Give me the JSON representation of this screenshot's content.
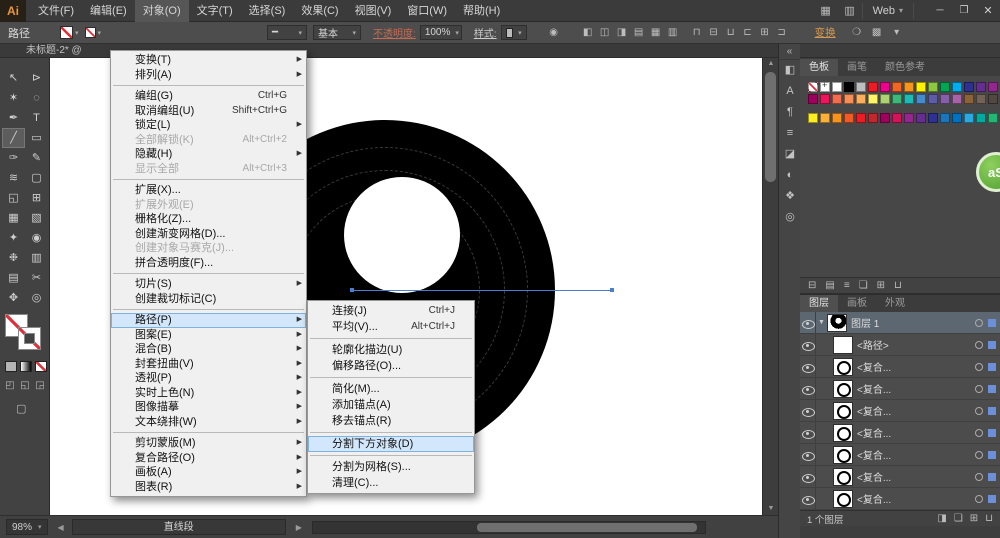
{
  "ui": {
    "caret": "▾",
    "menu_arrow": "▶",
    "up_arrow": "▲",
    "down_arrow": "▼",
    "left_arrow": "◀",
    "right_arrow": "▶",
    "expand_dock": "«",
    "panel_menu": "≡",
    "profile_glyph": "━"
  },
  "title_bar": {
    "logo": "Ai",
    "menus": [
      {
        "label": "文件(F)",
        "name": "menubar-file"
      },
      {
        "label": "编辑(E)",
        "name": "menubar-edit"
      },
      {
        "label": "对象(O)",
        "name": "menubar-object",
        "open": true
      },
      {
        "label": "文字(T)",
        "name": "menubar-type"
      },
      {
        "label": "选择(S)",
        "name": "menubar-select"
      },
      {
        "label": "效果(C)",
        "name": "menubar-effect"
      },
      {
        "label": "视图(V)",
        "name": "menubar-view"
      },
      {
        "label": "窗口(W)",
        "name": "menubar-window"
      },
      {
        "label": "帮助(H)",
        "name": "menubar-help"
      }
    ],
    "icons": [
      {
        "name": "arrange-documents-icon",
        "glyph": "▦"
      },
      {
        "name": "document-layout-icon",
        "glyph": "▥"
      }
    ],
    "workspace": "Web",
    "window_controls": [
      {
        "name": "minimize-button",
        "glyph": "─"
      },
      {
        "name": "restore-button",
        "glyph": "❐"
      },
      {
        "name": "close-button",
        "glyph": "✕"
      }
    ]
  },
  "control_bar": {
    "context_label": "路径",
    "brush_def": "基本",
    "opacity_label": "不透明度:",
    "opacity_value": "100%",
    "style_label": "样式:",
    "transform_label": "变换",
    "extra_icons": [
      {
        "name": "recolor-artwork-icon",
        "glyph": "◉"
      }
    ],
    "align_icons": [
      {
        "name": "align-left-icon",
        "glyph": "◧"
      },
      {
        "name": "align-h-center-icon",
        "glyph": "◫"
      },
      {
        "name": "align-right-icon",
        "glyph": "◨"
      },
      {
        "name": "align-top-icon",
        "glyph": "▤"
      },
      {
        "name": "align-v-center-icon",
        "glyph": "▦"
      },
      {
        "name": "align-bottom-icon",
        "glyph": "▥"
      }
    ],
    "distribute_icons": [
      {
        "name": "distribute-top-icon",
        "glyph": "⊓"
      },
      {
        "name": "distribute-v-center-icon",
        "glyph": "⊟"
      },
      {
        "name": "distribute-bottom-icon",
        "glyph": "⊔"
      },
      {
        "name": "distribute-left-icon",
        "glyph": "⊏"
      },
      {
        "name": "distribute-h-center-icon",
        "glyph": "⊞"
      },
      {
        "name": "distribute-right-icon",
        "glyph": "⊐"
      }
    ],
    "right_icons": [
      {
        "name": "shape-mode-icon",
        "glyph": "❍"
      },
      {
        "name": "arrange-icon",
        "glyph": "▩"
      },
      {
        "name": "panel-options-icon",
        "glyph": "▾"
      }
    ]
  },
  "document_tab": {
    "label": "未标题-2* @"
  },
  "tools": [
    {
      "name": "selection-tool",
      "glyph": "↖"
    },
    {
      "name": "direct-selection-tool",
      "glyph": "⊳"
    },
    {
      "name": "magic-wand-tool",
      "glyph": "✶"
    },
    {
      "name": "lasso-tool",
      "glyph": "◌"
    },
    {
      "name": "pen-tool",
      "glyph": "✒"
    },
    {
      "name": "type-tool",
      "glyph": "T"
    },
    {
      "name": "line-segment-tool",
      "glyph": "╱",
      "active": true
    },
    {
      "name": "rectangle-tool",
      "glyph": "▭"
    },
    {
      "name": "paintbrush-tool",
      "glyph": "✑"
    },
    {
      "name": "pencil-tool",
      "glyph": "✎"
    },
    {
      "name": "width-tool",
      "glyph": "≋"
    },
    {
      "name": "free-transform-tool",
      "glyph": "▢"
    },
    {
      "name": "shape-builder-tool",
      "glyph": "◱"
    },
    {
      "name": "perspective-grid-tool",
      "glyph": "⊞"
    },
    {
      "name": "mesh-tool",
      "glyph": "▦"
    },
    {
      "name": "gradient-tool",
      "glyph": "▧"
    },
    {
      "name": "eyedropper-tool",
      "glyph": "✦"
    },
    {
      "name": "blend-tool",
      "glyph": "◉"
    },
    {
      "name": "symbol-sprayer-tool",
      "glyph": "❉"
    },
    {
      "name": "column-graph-tool",
      "glyph": "▥"
    },
    {
      "name": "artboard-tool",
      "glyph": "▤"
    },
    {
      "name": "slice-tool",
      "glyph": "✂"
    },
    {
      "name": "hand-tool",
      "glyph": "✥"
    },
    {
      "name": "zoom-tool",
      "glyph": "◎"
    }
  ],
  "tools_footer": {
    "mode_icons": [
      {
        "name": "draw-normal-icon",
        "glyph": "◰"
      },
      {
        "name": "draw-behind-icon",
        "glyph": "◱"
      },
      {
        "name": "draw-inside-icon",
        "glyph": "◲"
      }
    ],
    "screen_mode": {
      "name": "screen-mode-icon",
      "glyph": "▢"
    }
  },
  "object_menu": {
    "items": [
      {
        "label": "变换(T)",
        "arrow": true
      },
      {
        "label": "排列(A)",
        "arrow": true
      },
      {
        "type": "sep"
      },
      {
        "label": "编组(G)",
        "shortcut": "Ctrl+G"
      },
      {
        "label": "取消编组(U)",
        "shortcut": "Shift+Ctrl+G"
      },
      {
        "label": "锁定(L)",
        "arrow": true
      },
      {
        "label": "全部解锁(K)",
        "shortcut": "Alt+Ctrl+2",
        "disabled": true
      },
      {
        "label": "隐藏(H)",
        "arrow": true
      },
      {
        "label": "显示全部",
        "shortcut": "Alt+Ctrl+3",
        "disabled": true
      },
      {
        "type": "sep"
      },
      {
        "label": "扩展(X)..."
      },
      {
        "label": "扩展外观(E)",
        "disabled": true
      },
      {
        "label": "栅格化(Z)..."
      },
      {
        "label": "创建渐变网格(D)..."
      },
      {
        "label": "创建对象马赛克(J)...",
        "disabled": true
      },
      {
        "label": "拼合透明度(F)..."
      },
      {
        "type": "sep"
      },
      {
        "label": "切片(S)",
        "arrow": true
      },
      {
        "label": "创建裁切标记(C)"
      },
      {
        "type": "sep"
      },
      {
        "label": "路径(P)",
        "arrow": true,
        "highlight": true,
        "name": "menu-item-path"
      },
      {
        "label": "图案(E)",
        "arrow": true
      },
      {
        "label": "混合(B)",
        "arrow": true
      },
      {
        "label": "封套扭曲(V)",
        "arrow": true
      },
      {
        "label": "透视(P)",
        "arrow": true
      },
      {
        "label": "实时上色(N)",
        "arrow": true
      },
      {
        "label": "图像描摹",
        "arrow": true
      },
      {
        "label": "文本绕排(W)",
        "arrow": true
      },
      {
        "type": "sep"
      },
      {
        "label": "剪切蒙版(M)",
        "arrow": true
      },
      {
        "label": "复合路径(O)",
        "arrow": true
      },
      {
        "label": "画板(A)",
        "arrow": true
      },
      {
        "label": "图表(R)",
        "arrow": true
      }
    ]
  },
  "path_submenu": {
    "items": [
      {
        "label": "连接(J)",
        "shortcut": "Ctrl+J"
      },
      {
        "label": "平均(V)...",
        "shortcut": "Alt+Ctrl+J"
      },
      {
        "type": "sep"
      },
      {
        "label": "轮廓化描边(U)"
      },
      {
        "label": "偏移路径(O)..."
      },
      {
        "type": "sep"
      },
      {
        "label": "简化(M)..."
      },
      {
        "label": "添加锚点(A)"
      },
      {
        "label": "移去锚点(R)"
      },
      {
        "type": "sep"
      },
      {
        "label": "分割下方对象(D)",
        "highlight": true,
        "name": "menu-item-divide-objects-below"
      },
      {
        "type": "sep"
      },
      {
        "label": "分割为网格(S)..."
      },
      {
        "label": "清理(C)..."
      }
    ]
  },
  "dock_icons": [
    {
      "name": "color-panel-icon",
      "glyph": "◧"
    },
    {
      "name": "character-panel-icon",
      "glyph": "A"
    },
    {
      "name": "paragraph-panel-icon",
      "glyph": "¶"
    },
    {
      "name": "stroke-panel-icon",
      "glyph": "≡"
    },
    {
      "name": "gradient-panel-icon",
      "glyph": "◪"
    },
    {
      "name": "transparency-panel-icon",
      "glyph": "◐"
    },
    {
      "name": "symbols-panel-icon",
      "glyph": "❖"
    },
    {
      "name": "appearance-panel-icon",
      "glyph": "◎"
    }
  ],
  "swatches": {
    "tabs": [
      {
        "label": "色板",
        "active": true
      },
      {
        "label": "画笔"
      },
      {
        "label": "颜色参考"
      }
    ],
    "row1": [
      "none",
      "reg",
      "#ffffff",
      "#000000",
      "#bcbec0",
      "#ed1c24",
      "#ec008c",
      "#f26522",
      "#f7941d",
      "#fff200",
      "#8dc63f",
      "#00a651",
      "#00aeef",
      "#2e3192",
      "#662d91",
      "#92278f"
    ],
    "row2": [
      "#9e005d",
      "#ed145b",
      "#f26c4f",
      "#f68e55",
      "#fbaf5c",
      "#fff467",
      "#acd372",
      "#3cb878",
      "#1cbbb4",
      "#448ccb",
      "#5e5ca7",
      "#855fa8",
      "#a763a9",
      "#8c6239",
      "#736357",
      "#534741"
    ],
    "row3": [
      "#fcee21",
      "#fbb03b",
      "#f7931e",
      "#f15a24",
      "#ed1c24",
      "#c1272d",
      "#9e005d",
      "#d4145a",
      "#93278f",
      "#662d91",
      "#2e3192",
      "#1b75bb",
      "#0071bc",
      "#29abe2",
      "#00a99d",
      "#22b573"
    ],
    "row4": [
      "#006837",
      "#8cc63f",
      "#d9e021",
      "#ffffff",
      "#e6e6e6",
      "#cccccc",
      "#b3b3b3",
      "#999999",
      "#808080",
      "#4d4d4d",
      "#333333",
      "#1a1a1a",
      "#000000",
      "folder",
      "folder",
      "folder"
    ],
    "footer_icons": [
      {
        "name": "swatch-libraries-icon",
        "glyph": "⊟"
      },
      {
        "name": "swatch-kinds-icon",
        "glyph": "▤"
      },
      {
        "name": "swatch-options-icon",
        "glyph": "≡"
      },
      {
        "name": "new-color-group-icon",
        "glyph": "❏"
      },
      {
        "name": "new-swatch-icon",
        "glyph": "⊞"
      },
      {
        "name": "delete-swatch-icon",
        "glyph": "⊔"
      }
    ]
  },
  "layers": {
    "tabs": [
      {
        "label": "图层",
        "active": true
      },
      {
        "label": "画板"
      },
      {
        "label": "外观"
      }
    ],
    "rows": [
      {
        "label": "图层 1",
        "thumb": "donut",
        "selected": true,
        "expanded": true,
        "name": "layer-row"
      },
      {
        "label": "<路径>",
        "thumb": "square",
        "name": "path-row"
      },
      {
        "label": "<复合...",
        "thumb": "ring",
        "name": "compound-path-row"
      },
      {
        "label": "<复合...",
        "thumb": "ring",
        "name": "compound-path-row"
      },
      {
        "label": "<复合...",
        "thumb": "ring",
        "name": "compound-path-row"
      },
      {
        "label": "<复合...",
        "thumb": "ring",
        "name": "compound-path-row"
      },
      {
        "label": "<复合...",
        "thumb": "ring",
        "name": "compound-path-row"
      },
      {
        "label": "<复合...",
        "thumb": "ring",
        "name": "compound-path-row"
      },
      {
        "label": "<复合...",
        "thumb": "ring",
        "name": "compound-path-row"
      }
    ],
    "footer": "1 个图层",
    "footer_icons": [
      {
        "name": "make-clipping-mask-icon",
        "glyph": "◨"
      },
      {
        "name": "new-sublayer-icon",
        "glyph": "❏"
      },
      {
        "name": "new-layer-icon",
        "glyph": "⊞"
      },
      {
        "name": "delete-layer-icon",
        "glyph": "⊔"
      }
    ]
  },
  "status_bar": {
    "zoom": "98%",
    "tool_display": "直线段"
  },
  "canvas": {
    "shape_color": "#000000",
    "selection_color": "#4a7fd0"
  },
  "badge": {
    "label": "aS"
  }
}
